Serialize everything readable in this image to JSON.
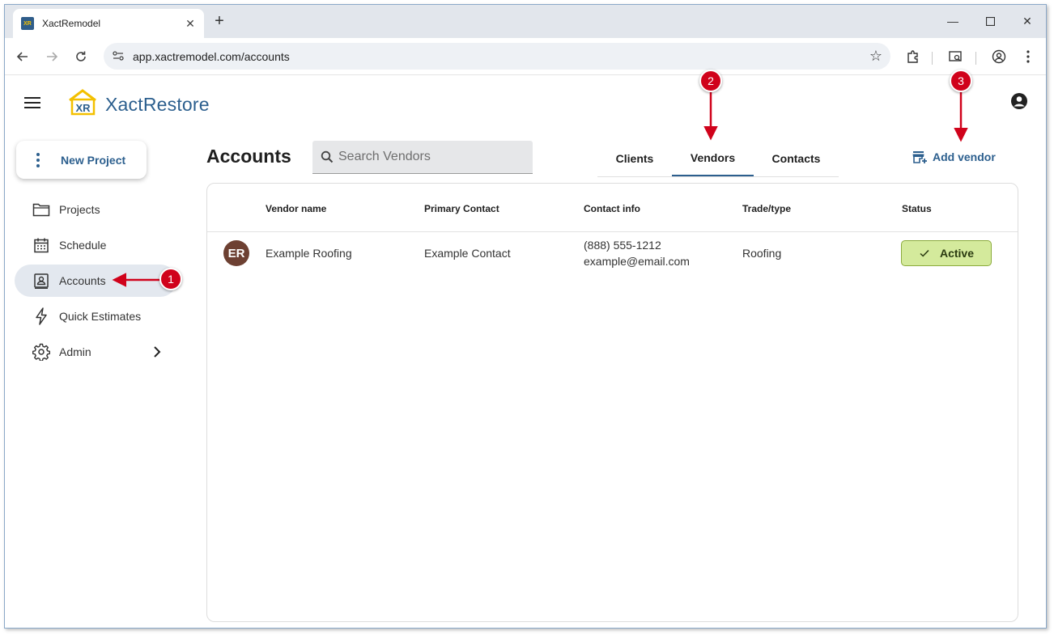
{
  "browser": {
    "tab_title": "XactRemodel",
    "url": "app.xactremodel.com/accounts"
  },
  "app": {
    "brand": "XactRestore",
    "logo_text": "XR",
    "new_project_label": "New Project",
    "nav": [
      {
        "label": "Projects",
        "icon": "folder-icon"
      },
      {
        "label": "Schedule",
        "icon": "calendar-icon"
      },
      {
        "label": "Accounts",
        "icon": "contact-card-icon",
        "active": true
      },
      {
        "label": "Quick Estimates",
        "icon": "lightning-icon"
      },
      {
        "label": "Admin",
        "icon": "gear-icon"
      }
    ]
  },
  "main": {
    "title": "Accounts",
    "search_placeholder": "Search Vendors",
    "tabs": [
      {
        "label": "Clients"
      },
      {
        "label": "Vendors",
        "active": true
      },
      {
        "label": "Contacts"
      }
    ],
    "add_vendor_label": "Add vendor",
    "table": {
      "columns": [
        "Vendor name",
        "Primary Contact",
        "Contact info",
        "Trade/type",
        "Status"
      ],
      "rows": [
        {
          "initials": "ER",
          "vendor_name": "Example Roofing",
          "primary_contact": "Example Contact",
          "phone": "(888) 555-1212",
          "email": "example@email.com",
          "trade": "Roofing",
          "status": "Active"
        }
      ]
    }
  },
  "annotations": [
    "1",
    "2",
    "3"
  ],
  "colors": {
    "brand": "#2c5f8e",
    "active_status_bg": "#d4ea9c",
    "annotation_red": "#d0021b",
    "avatar": "#6d4032"
  }
}
